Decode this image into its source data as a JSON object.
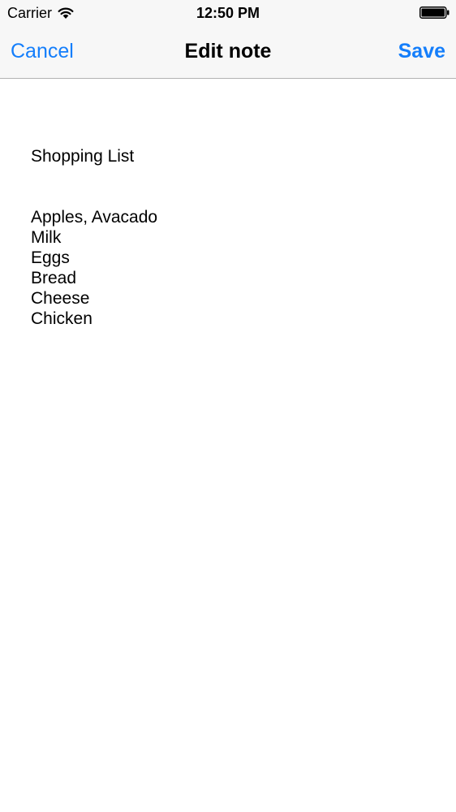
{
  "status_bar": {
    "carrier": "Carrier",
    "time": "12:50 PM",
    "wifi_icon": "wifi-icon",
    "battery_icon": "battery-full-icon"
  },
  "nav_bar": {
    "cancel_label": "Cancel",
    "title": "Edit note",
    "save_label": "Save",
    "accent_color": "#147efb"
  },
  "note": {
    "content": "Shopping List\n\n\nApples, Avacado\nMilk\nEggs\nBread\nCheese\nChicken"
  }
}
